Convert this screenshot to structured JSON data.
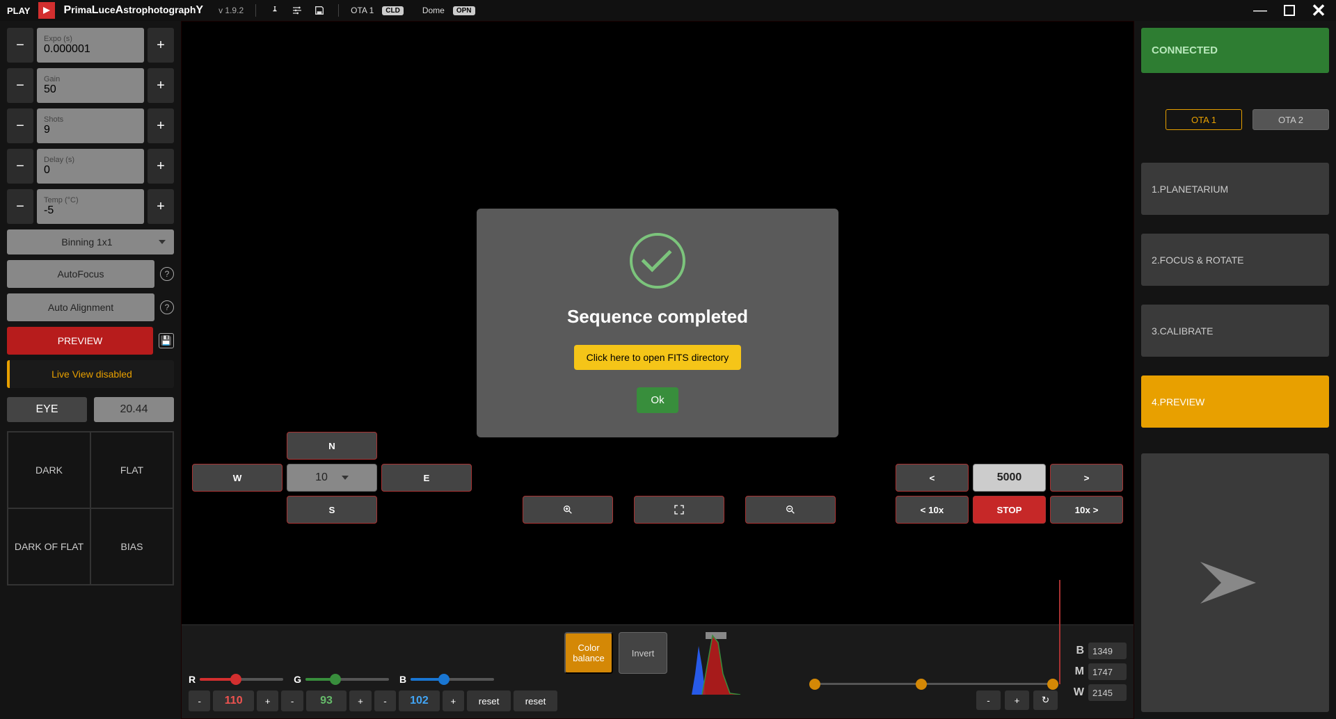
{
  "titlebar": {
    "play": "PLAY",
    "app_name_pre": "P",
    "app_name_mid1": "rima",
    "app_name_l": "L",
    "app_name_mid2": "uce",
    "app_name_a": "A",
    "app_name_mid3": "strophotograph",
    "app_name_y": "Y",
    "version": "v 1.9.2",
    "ota_label": "OTA 1",
    "ota_status": "CLD",
    "dome_label": "Dome",
    "dome_status": "OPN"
  },
  "left": {
    "expo": {
      "label": "Expo (s)",
      "value": "0.000001"
    },
    "gain": {
      "label": "Gain",
      "value": "50"
    },
    "shots": {
      "label": "Shots",
      "value": "9"
    },
    "delay": {
      "label": "Delay (s)",
      "value": "0"
    },
    "temp": {
      "label": "Temp (°C)",
      "value": "-5"
    },
    "binning": "Binning 1x1",
    "autofocus": "AutoFocus",
    "autoalign": "Auto Alignment",
    "preview": "PREVIEW",
    "liveview": "Live View disabled",
    "eye_label": "EYE",
    "eye_value": "20.44",
    "calib": {
      "dark": "DARK",
      "flat": "FLAT",
      "darkflat": "DARK OF FLAT",
      "bias": "BIAS"
    }
  },
  "dpad": {
    "n": "N",
    "s": "S",
    "e": "E",
    "w": "W",
    "speed": "10"
  },
  "play": {
    "back": "<",
    "fwd": ">",
    "value": "5000",
    "back10": "< 10x",
    "fwd10": "10x >",
    "stop": "STOP"
  },
  "bottom": {
    "r_label": "R",
    "g_label": "G",
    "b_label": "B",
    "r_val": "110",
    "g_val": "93",
    "b_val": "102",
    "reset": "reset",
    "color_balance": "Color balance",
    "invert": "Invert",
    "bmw": {
      "b_label": "B",
      "b_val": "1349",
      "m_label": "M",
      "m_val": "1747",
      "w_label": "W",
      "w_val": "2145"
    }
  },
  "right": {
    "connected": "CONNECTED",
    "ota1": "OTA 1",
    "ota2": "OTA 2",
    "steps": [
      "1.PLANETARIUM",
      "2.FOCUS & ROTATE",
      "3.CALIBRATE",
      "4.PREVIEW"
    ]
  },
  "modal": {
    "title": "Sequence completed",
    "link": "Click here to open FITS directory",
    "ok": "Ok"
  }
}
